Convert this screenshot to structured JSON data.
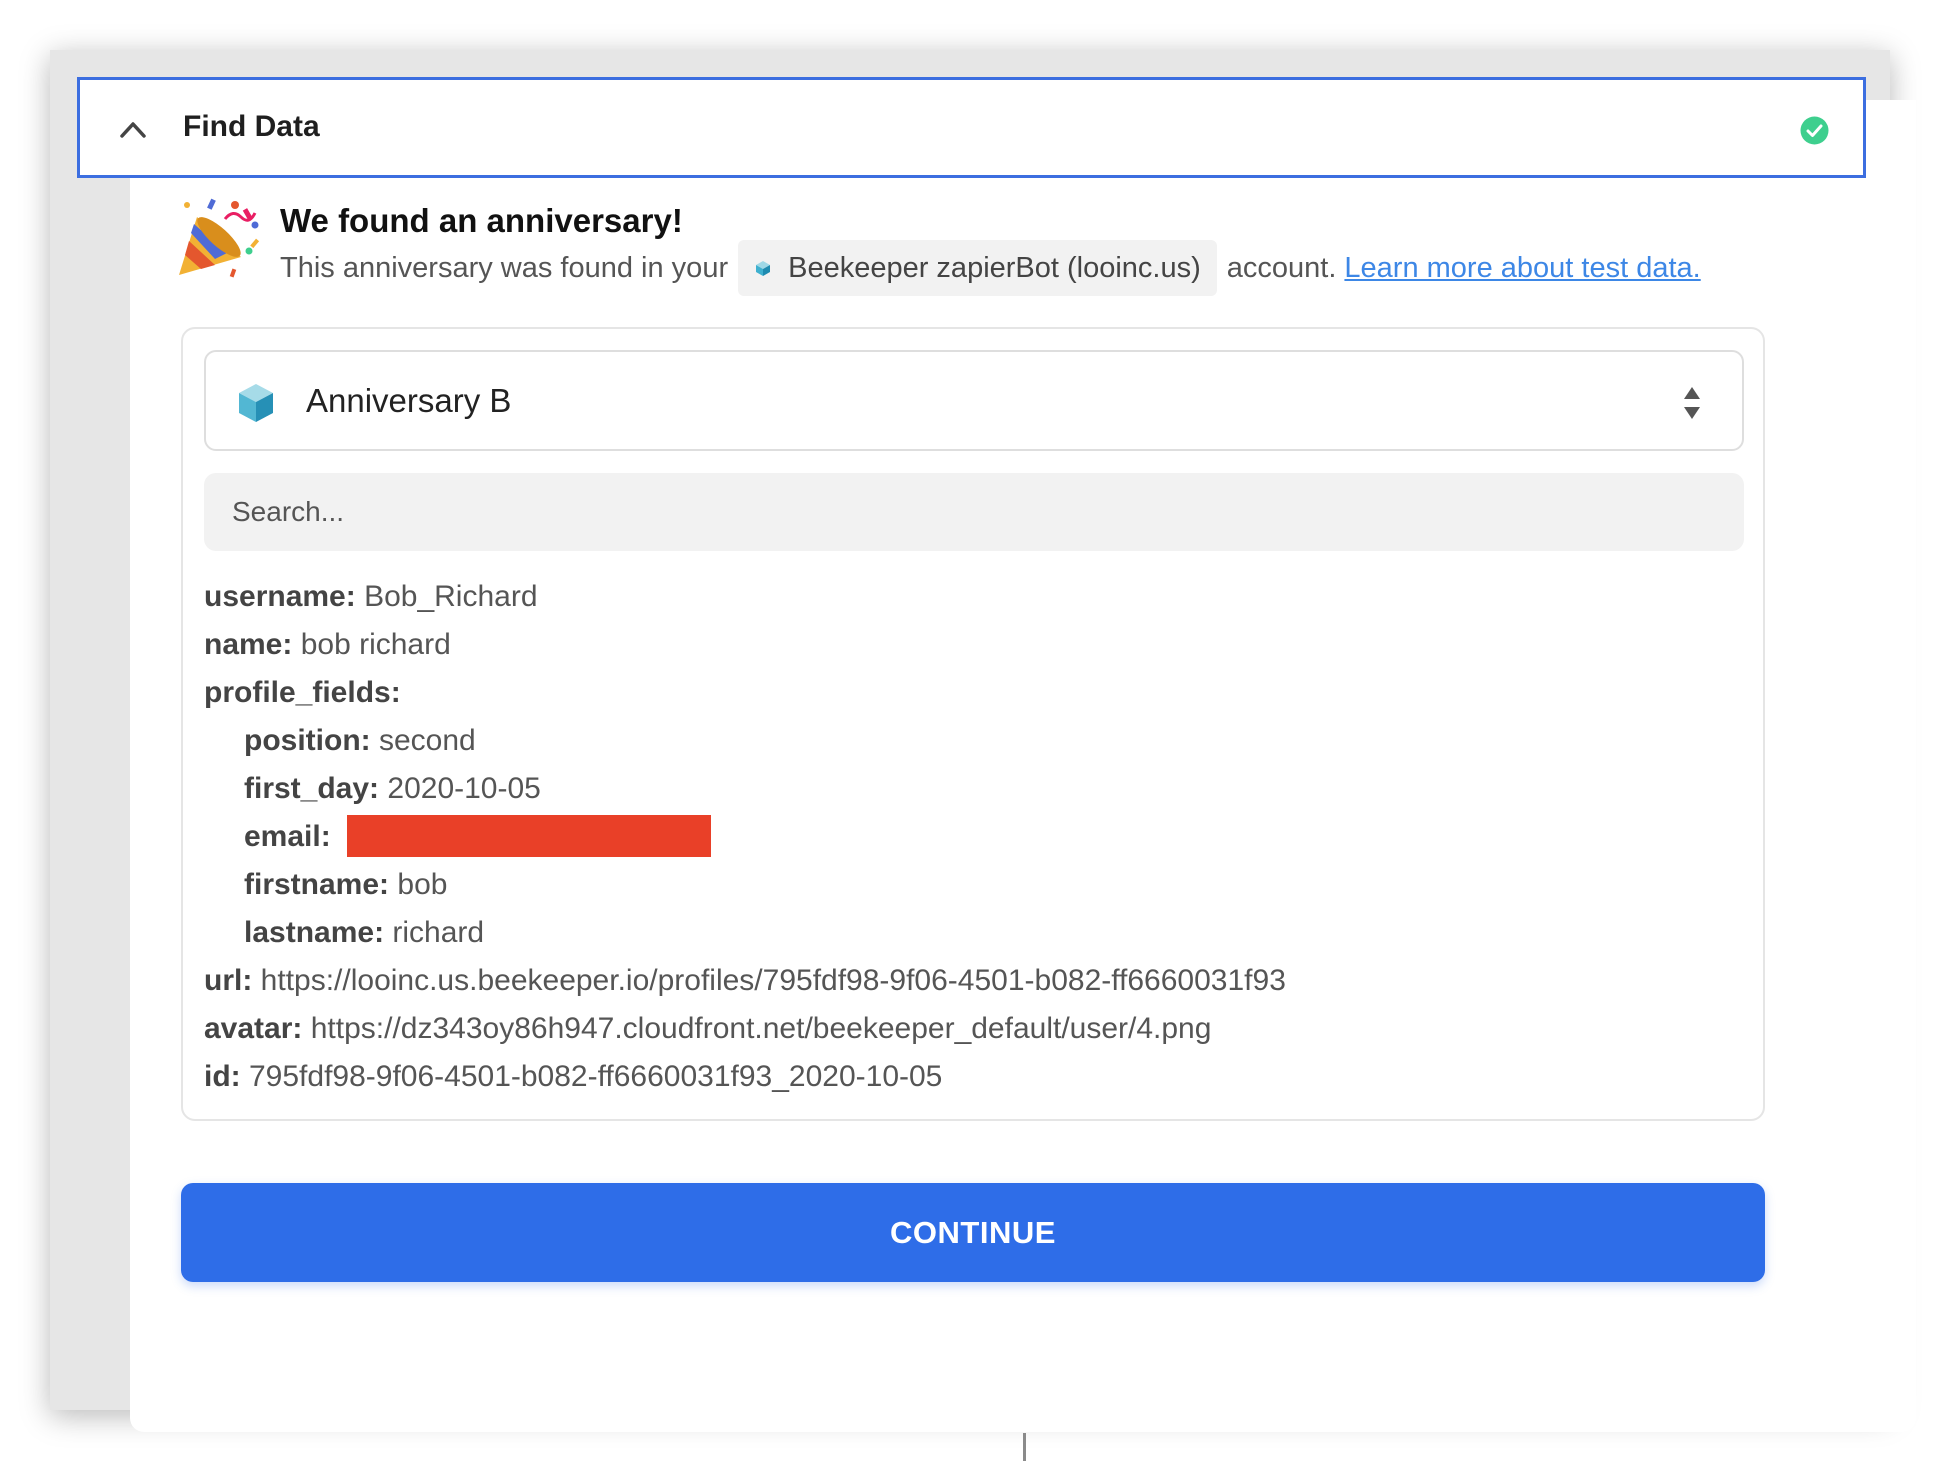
{
  "step": {
    "title": "Find Data",
    "status_color": "#3ecf8e"
  },
  "found": {
    "title": "We found an anniversary!",
    "line_prefix": "This anniversary was found in your",
    "account_name": "Beekeeper zapierBot (looinc.us)",
    "line_suffix": "account.",
    "learn_link": "Learn more about test data."
  },
  "record_select": {
    "selected": "Anniversary B"
  },
  "search": {
    "placeholder": "Search..."
  },
  "fields": {
    "username": {
      "key": "username:",
      "value": "Bob_Richard"
    },
    "name": {
      "key": "name:",
      "value": "bob richard"
    },
    "profile_fields": {
      "key": "profile_fields:"
    },
    "position": {
      "key": "position:",
      "value": "second"
    },
    "first_day": {
      "key": "first_day:",
      "value": "2020-10-05"
    },
    "email": {
      "key": "email:"
    },
    "firstname": {
      "key": "firstname:",
      "value": "bob"
    },
    "lastname": {
      "key": "lastname:",
      "value": "richard"
    },
    "url": {
      "key": "url:",
      "value": "https://looinc.us.beekeeper.io/profiles/795fdf98-9f06-4501-b082-ff6660031f93"
    },
    "avatar": {
      "key": "avatar:",
      "value": "https://dz343oy86h947.cloudfront.net/beekeeper_default/user/4.png"
    },
    "id": {
      "key": "id:",
      "value": "795fdf98-9f06-4501-b082-ff6660031f93_2020-10-05"
    }
  },
  "continue_button": {
    "label": "CONTINUE"
  },
  "colors": {
    "accent": "#2e6de8",
    "header_border": "#3c6ee0",
    "link": "#3d87e6",
    "redaction": "#e94028"
  },
  "icons": [
    "chevron-up-icon",
    "check-circle-icon",
    "party-popper-icon",
    "beekeeper-cube-icon",
    "sort-arrows-icon"
  ]
}
